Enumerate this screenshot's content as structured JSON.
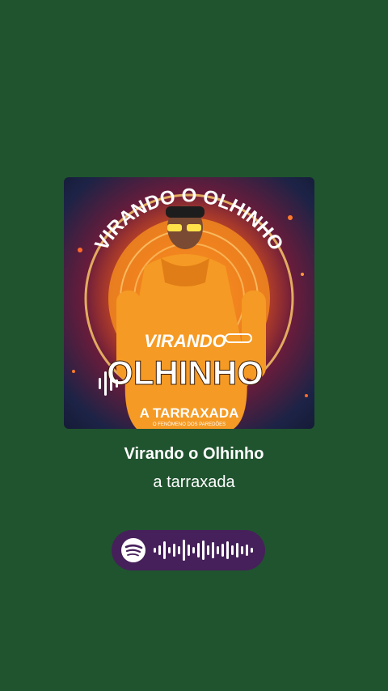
{
  "track": {
    "title": "Virando o Olhinho",
    "artist": "a tarraxada"
  },
  "cover_art": {
    "arc_text": "VIRANDO O OLHINHO",
    "title_line1": "VIRANDO",
    "title_line2": "OLHINHO",
    "brand": "A TARRAXADA",
    "brand_sub": "O FENÔMENO DOS PAREDÕES"
  },
  "spotify_code": {
    "icon": "spotify-icon",
    "background_color": "#46205a"
  },
  "colors": {
    "background": "#20542f",
    "accent_orange": "#f28a1e"
  }
}
